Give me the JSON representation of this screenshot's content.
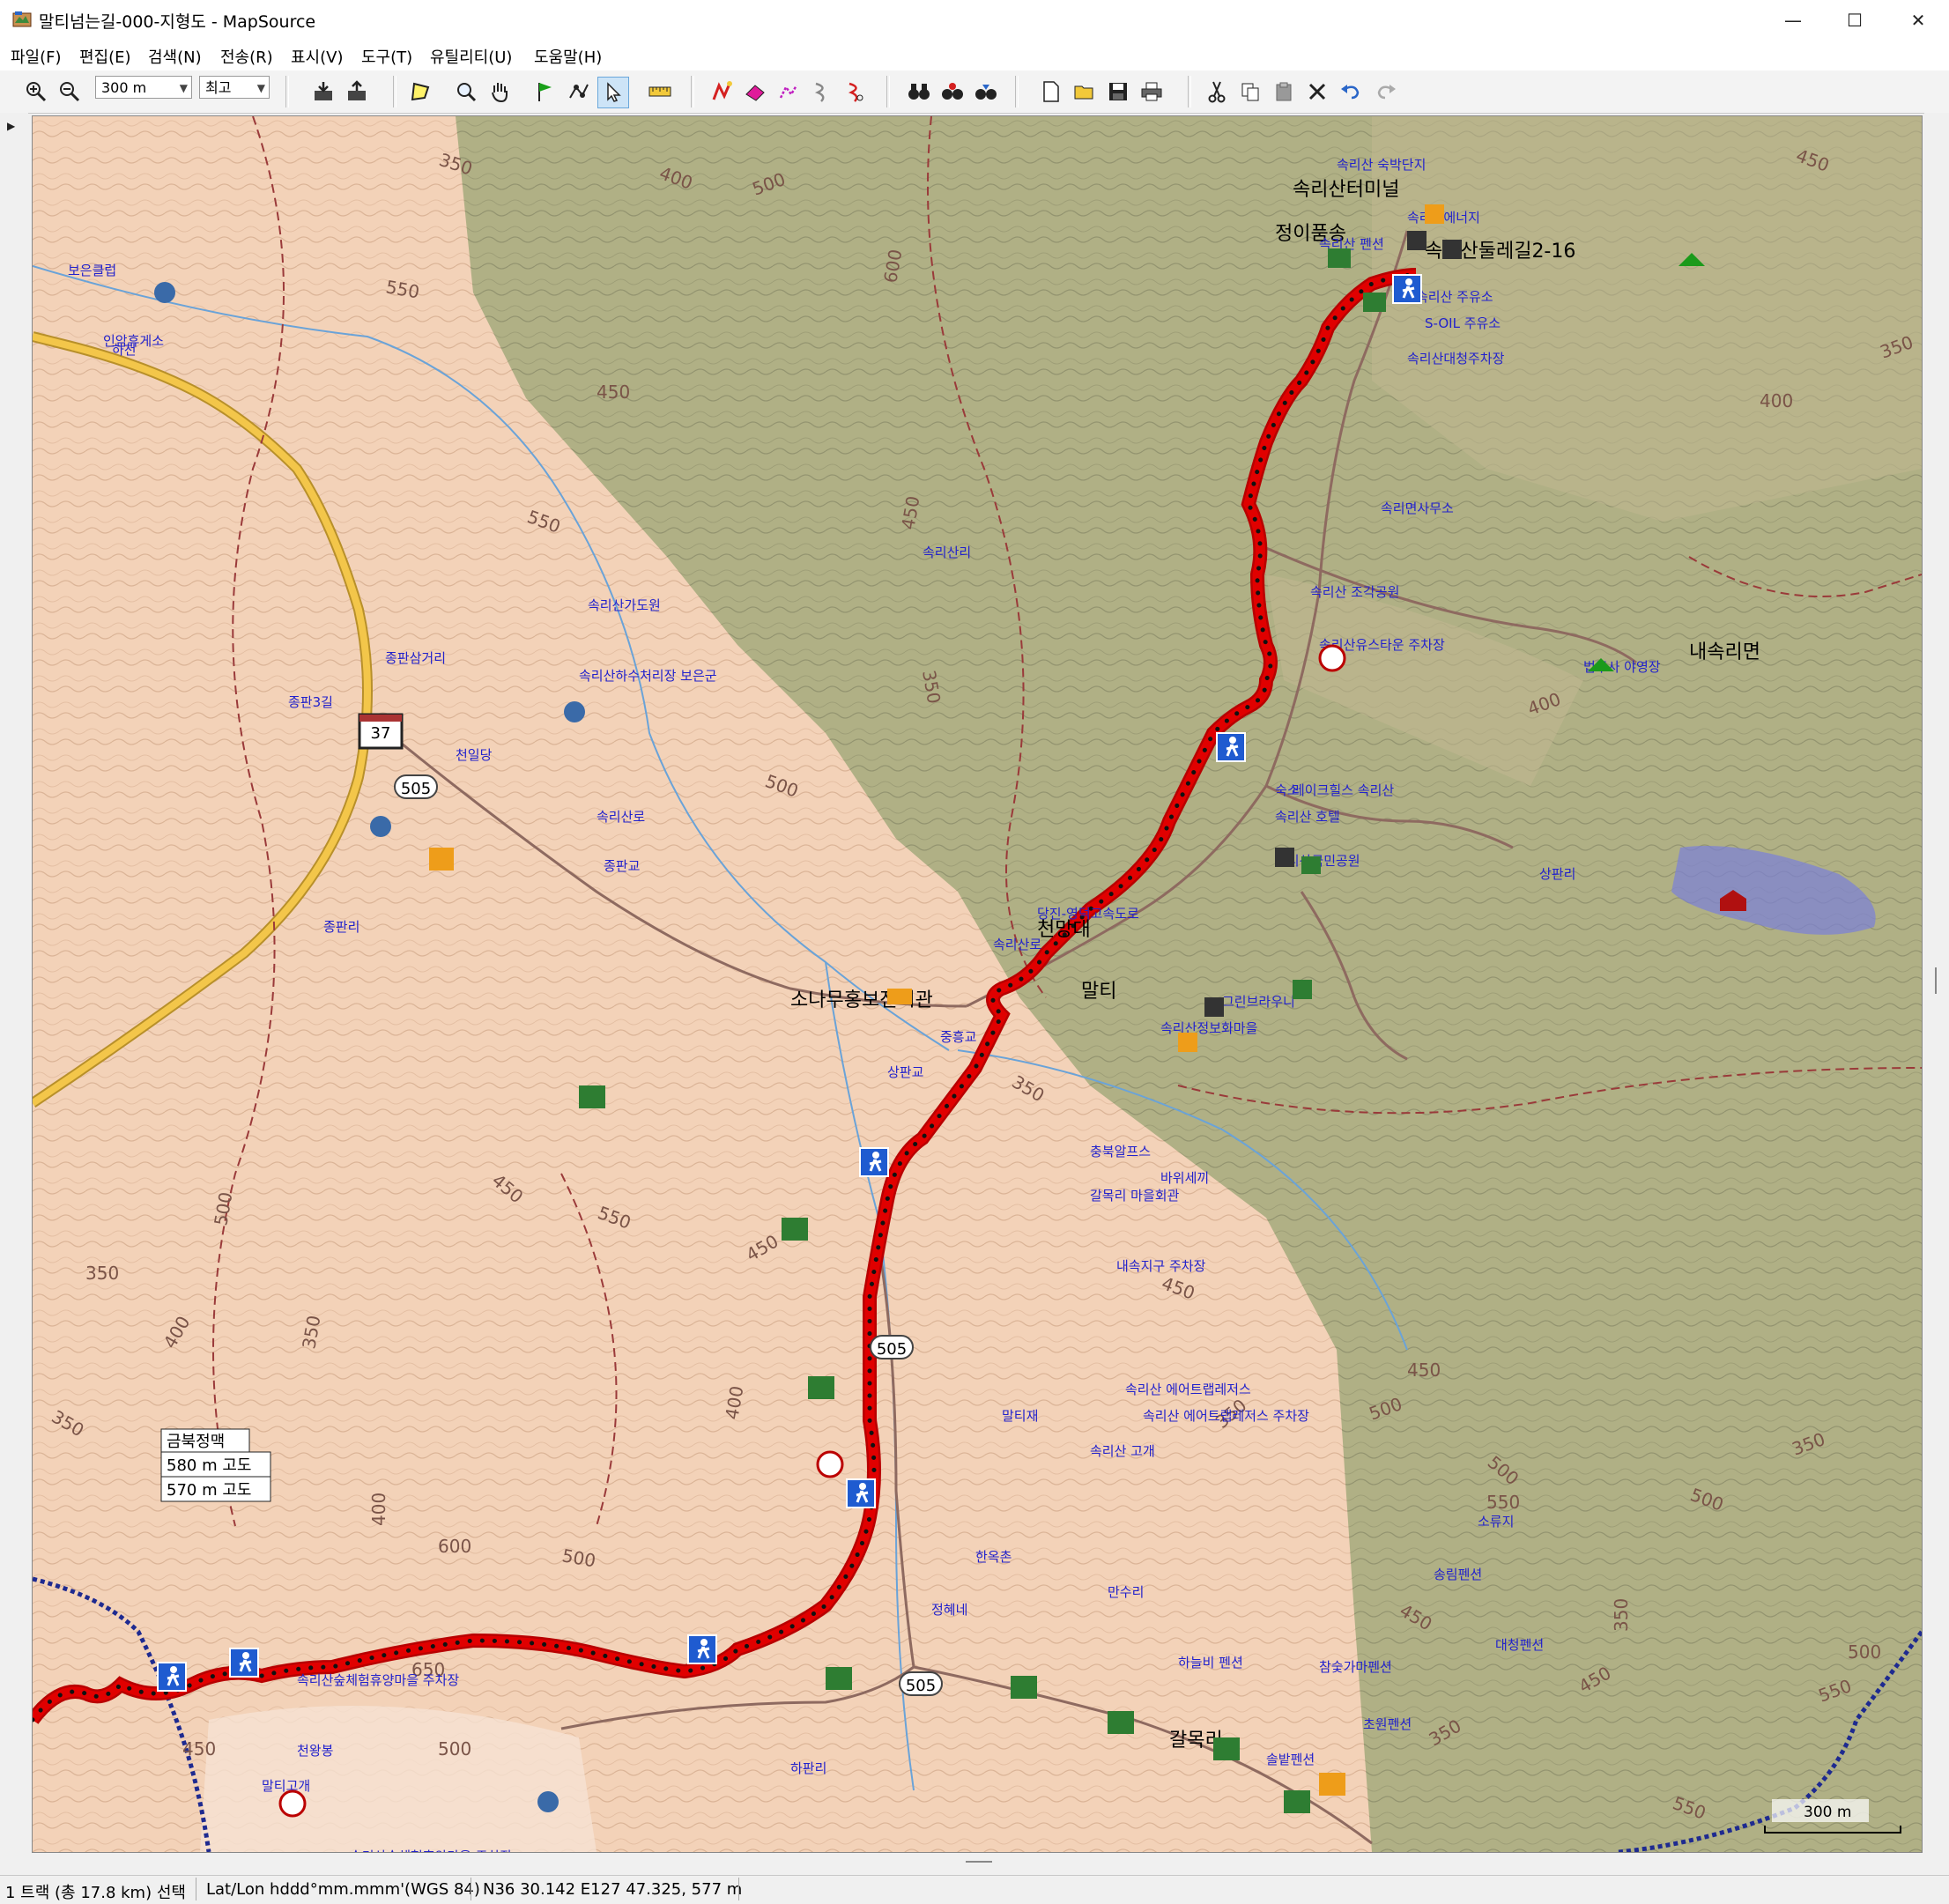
{
  "window": {
    "title": "말티넘는길-000-지형도 - MapSource",
    "minimize": "—",
    "maximize": "☐",
    "close": "✕"
  },
  "menu": [
    "파일(F)",
    "편집(E)",
    "검색(N)",
    "전송(R)",
    "표시(V)",
    "도구(T)",
    "유틸리티(U)",
    "도움말(H)"
  ],
  "toolbar": {
    "zoom_level": "300 m",
    "detail_level": "최고"
  },
  "map": {
    "contours": [
      "350",
      "400",
      "500",
      "550",
      "450",
      "600",
      "550",
      "450",
      "350",
      "500",
      "450",
      "350",
      "400",
      "400",
      "350",
      "450",
      "550",
      "450",
      "400",
      "350",
      "500",
      "450",
      "500",
      "550",
      "350",
      "500",
      "600",
      "650",
      "500",
      "450",
      "350",
      "400",
      "350",
      "400",
      "500",
      "450",
      "350",
      "500",
      "450",
      "350",
      "550",
      "500",
      "450",
      "350",
      "550"
    ],
    "route_labels": [
      {
        "text": "37"
      },
      {
        "text": "505"
      },
      {
        "text": "505"
      },
      {
        "text": "505"
      },
      {
        "text": "505"
      }
    ],
    "place_labels": [
      "하천",
      "종판3길",
      "종판삼거리",
      "천일당",
      "속리산가도원",
      "속리산하수처리장 보은군",
      "종판교",
      "종판리",
      "속리산리",
      "속리산로",
      "내속리면",
      "상판리",
      "하판리",
      "갈목리",
      "소나무홍보전시관",
      "한옥촌",
      "만수리",
      "천왕봉",
      "말티고개",
      "속리산터미널",
      "속리산둘레길2-16",
      "정이품송",
      "말티",
      "천망대",
      "충북알프스",
      "속리산로",
      "내속지구 주차장",
      "숙소",
      "그린브라우니",
      "속리산정보화마을",
      "속리산유스타운 주차장",
      "법주사 야영장",
      "속리산숲체험휴양마을 주차장",
      "속리산숲체험휴양마을 주차장",
      "속리산국민공원",
      "속리산 조각공원",
      "속리산 호텔",
      "레이크힐스 속리산",
      "하늘비 펜션",
      "참숯가마펜션",
      "초원펜션",
      "속리산 에어트랩레저스",
      "속리산 에어트랩레저스 주차장",
      "중흥교",
      "상판교",
      "당진-영덕고속도로",
      "바위세끼",
      "속리산 펜션",
      "소류지",
      "송림펜션",
      "솔밭펜션",
      "대청펜션",
      "속리산 숙박단지",
      "갈목리 마을회관",
      "정혜네",
      "속리산에너지",
      "속리산 주유소",
      "S-OIL 주유소",
      "속리산대청주차장",
      "속리산 고개",
      "말티재",
      "인암휴게소",
      "보은클럽",
      "속리면사무소"
    ],
    "waypoints": [
      "속리산터미널",
      "정이품송",
      "속리산둘레길2-16",
      "갈목리",
      "소나무홍보전시관",
      "천망대",
      "말티"
    ],
    "track_tooltip": {
      "name": "금북정맥",
      "elev1": "580 m 고도",
      "elev2": "570 m 고도"
    },
    "scale": "300 m"
  },
  "status": {
    "selection": "1 트랙 (총 17.8 km) 선택",
    "format": "Lat/Lon hddd°mm.mmm'(WGS 84)",
    "position": "N36 30.142 E127 47.325, 577 m"
  },
  "colors": {
    "track": "#e00000",
    "terrain_light": "#f3d2b8",
    "terrain_forest": "#a9ac80",
    "road_yellow": "#f3c64a",
    "label_blue": "#2222cc",
    "water": "#7a80d8"
  }
}
